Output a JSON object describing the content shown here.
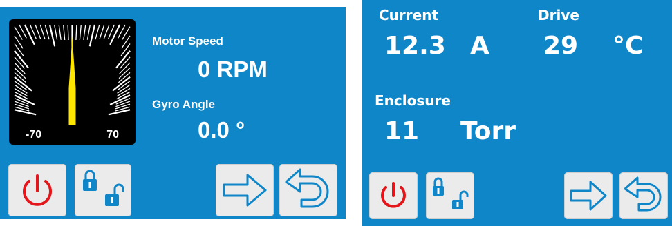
{
  "left_panel": {
    "gauge": {
      "min_label": "-70",
      "max_label": "70",
      "needle_value": 0
    },
    "motor_speed": {
      "label": "Motor Speed",
      "value": "0 RPM"
    },
    "gyro_angle": {
      "label": "Gyro Angle",
      "value": "0.0 °"
    }
  },
  "right_panel": {
    "current": {
      "label": "Current",
      "value": "12.3",
      "unit": "A"
    },
    "drive": {
      "label": "Drive",
      "value": "29",
      "unit": "°C"
    },
    "enclosure": {
      "label": "Enclosure",
      "value": "11",
      "unit": "Torr"
    }
  },
  "buttons": {
    "power": "power-icon",
    "lock": "lock-unlock-icon",
    "next": "arrow-right-icon",
    "back": "return-arrow-icon"
  },
  "colors": {
    "panel_background": "#0f86c8",
    "power_icon": "#e4151b",
    "arrow_icon": "#0f86c8",
    "lock_icon": "#0f86c8",
    "needle": "#ffe600",
    "button_face": "#ebebeb"
  }
}
